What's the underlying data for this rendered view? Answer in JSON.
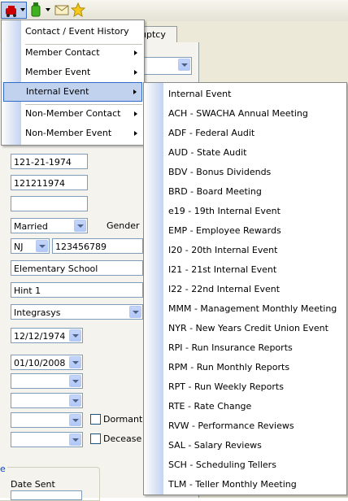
{
  "toolbar": {
    "icons": [
      "red-flag-icon",
      "green-bottle-icon",
      "envelope-icon",
      "star-icon"
    ]
  },
  "background": {
    "tab_label": "uptcy",
    "ssn_text": "121-21-1974",
    "id_text": "121211974",
    "empty_field": "",
    "marital_status": "Married",
    "gender_label": "Gender",
    "state": "NJ",
    "license_number": "123456789",
    "education": "Elementary School",
    "hint": "Hint 1",
    "company": "Integrasys",
    "birth_date": "12/12/1974",
    "join_date": "01/10/2008",
    "dormant_label": "Dormant",
    "deceased_label": "Decease",
    "group_title_fragment": "e",
    "date_sent_label": "Date Sent"
  },
  "context_menu": {
    "items": [
      {
        "label": "Contact / Event History",
        "has_submenu": false
      },
      {
        "label": "Member Contact",
        "has_submenu": true
      },
      {
        "label": "Member Event",
        "has_submenu": true
      },
      {
        "label": "Internal Event",
        "has_submenu": true,
        "highlighted": true
      },
      {
        "label": "Non-Member Contact",
        "has_submenu": true
      },
      {
        "label": "Non-Member Event",
        "has_submenu": true
      }
    ]
  },
  "submenu": {
    "items": [
      "Internal Event",
      "ACH - SWACHA Annual Meeting",
      "ADF - Federal Audit",
      "AUD - State Audit",
      "BDV - Bonus Dividends",
      "BRD - Board Meeting",
      "e19 - 19th Internal Event",
      "EMP - Employee Rewards",
      "I20 - 20th Internal Event",
      "I21 - 21st Internal Event",
      "I22 - 22nd Internal Event",
      "MMM - Management Monthly Meeting",
      "NYR - New Years Credit Union Event",
      "RPI - Run Insurance Reports",
      "RPM - Run Monthly Reports",
      "RPT - Run Weekly Reports",
      "RTE - Rate Change",
      "RVW - Performance Reviews",
      "SAL - Salary Reviews",
      "SCH - Scheduling Tellers",
      "TLM - Teller Monthly Meeting"
    ]
  },
  "colors": {
    "highlight_bg": "#c1d2ee",
    "highlight_border": "#316ac5",
    "menu_strip": "#c4d3f2",
    "group_title": "#0046d5"
  }
}
